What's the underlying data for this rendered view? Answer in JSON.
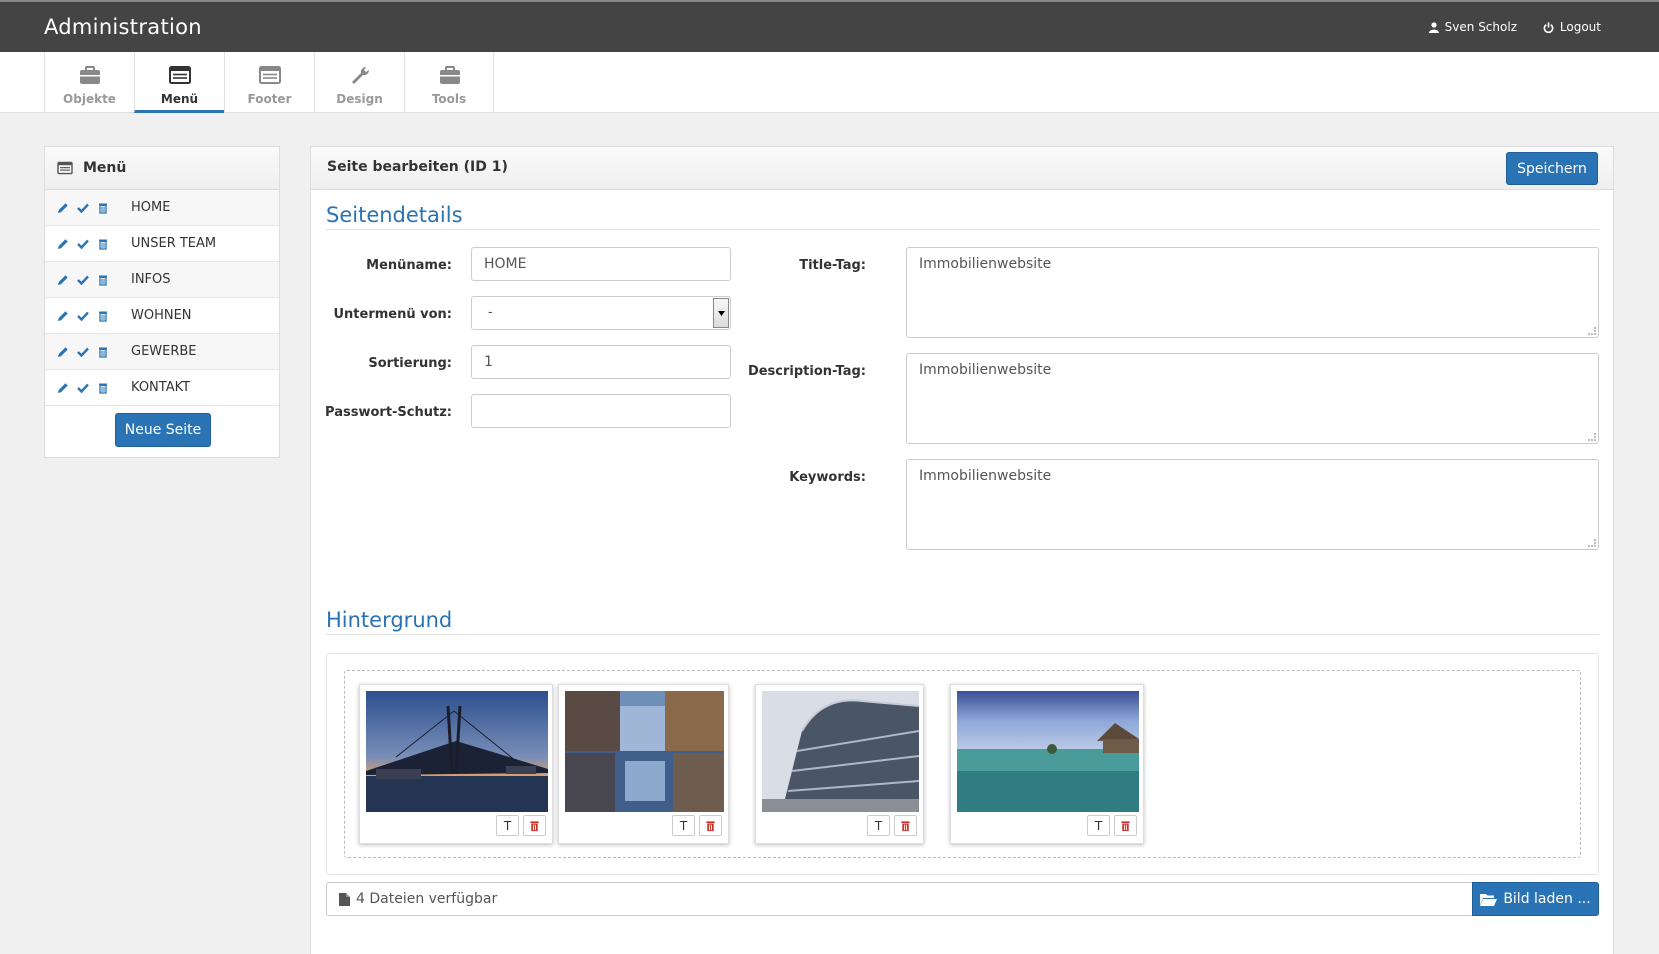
{
  "header": {
    "title": "Administration",
    "user": "Sven Scholz",
    "logout": "Logout"
  },
  "tabs": [
    {
      "label": "Objekte",
      "icon": "briefcase-icon"
    },
    {
      "label": "Menü",
      "icon": "list-icon",
      "active": true
    },
    {
      "label": "Footer",
      "icon": "list-icon"
    },
    {
      "label": "Design",
      "icon": "wrench-icon"
    },
    {
      "label": "Tools",
      "icon": "briefcase-icon"
    }
  ],
  "sidebar": {
    "title": "Menü",
    "items": [
      {
        "label": "HOME"
      },
      {
        "label": "UNSER TEAM"
      },
      {
        "label": "INFOS"
      },
      {
        "label": "WOHNEN"
      },
      {
        "label": "GEWERBE"
      },
      {
        "label": "KONTAKT"
      }
    ],
    "new_button": "Neue Seite"
  },
  "main": {
    "title": "Seite bearbeiten (ID 1)",
    "save_button": "Speichern",
    "section_details": "Seitendetails",
    "fields": {
      "menuname_label": "Menüname:",
      "menuname_value": "HOME",
      "untermenu_label": "Untermenü von:",
      "untermenu_value": "-",
      "sortierung_label": "Sortierung:",
      "sortierung_value": "1",
      "passwort_label": "Passwort-Schutz:",
      "passwort_value": "",
      "title_tag_label": "Title-Tag:",
      "title_tag_value": "Immobilienwebsite",
      "description_tag_label": "Description-Tag:",
      "description_tag_value": "Immobilienwebsite",
      "keywords_label": "Keywords:",
      "keywords_value": "Immobilienwebsite"
    },
    "section_background": "Hintergrund",
    "image_button_text": "T",
    "files_available": "4 Dateien verfügbar",
    "load_button": "Bild laden ..."
  },
  "colors": {
    "accent": "#2a73b4",
    "topbar": "#444444"
  }
}
